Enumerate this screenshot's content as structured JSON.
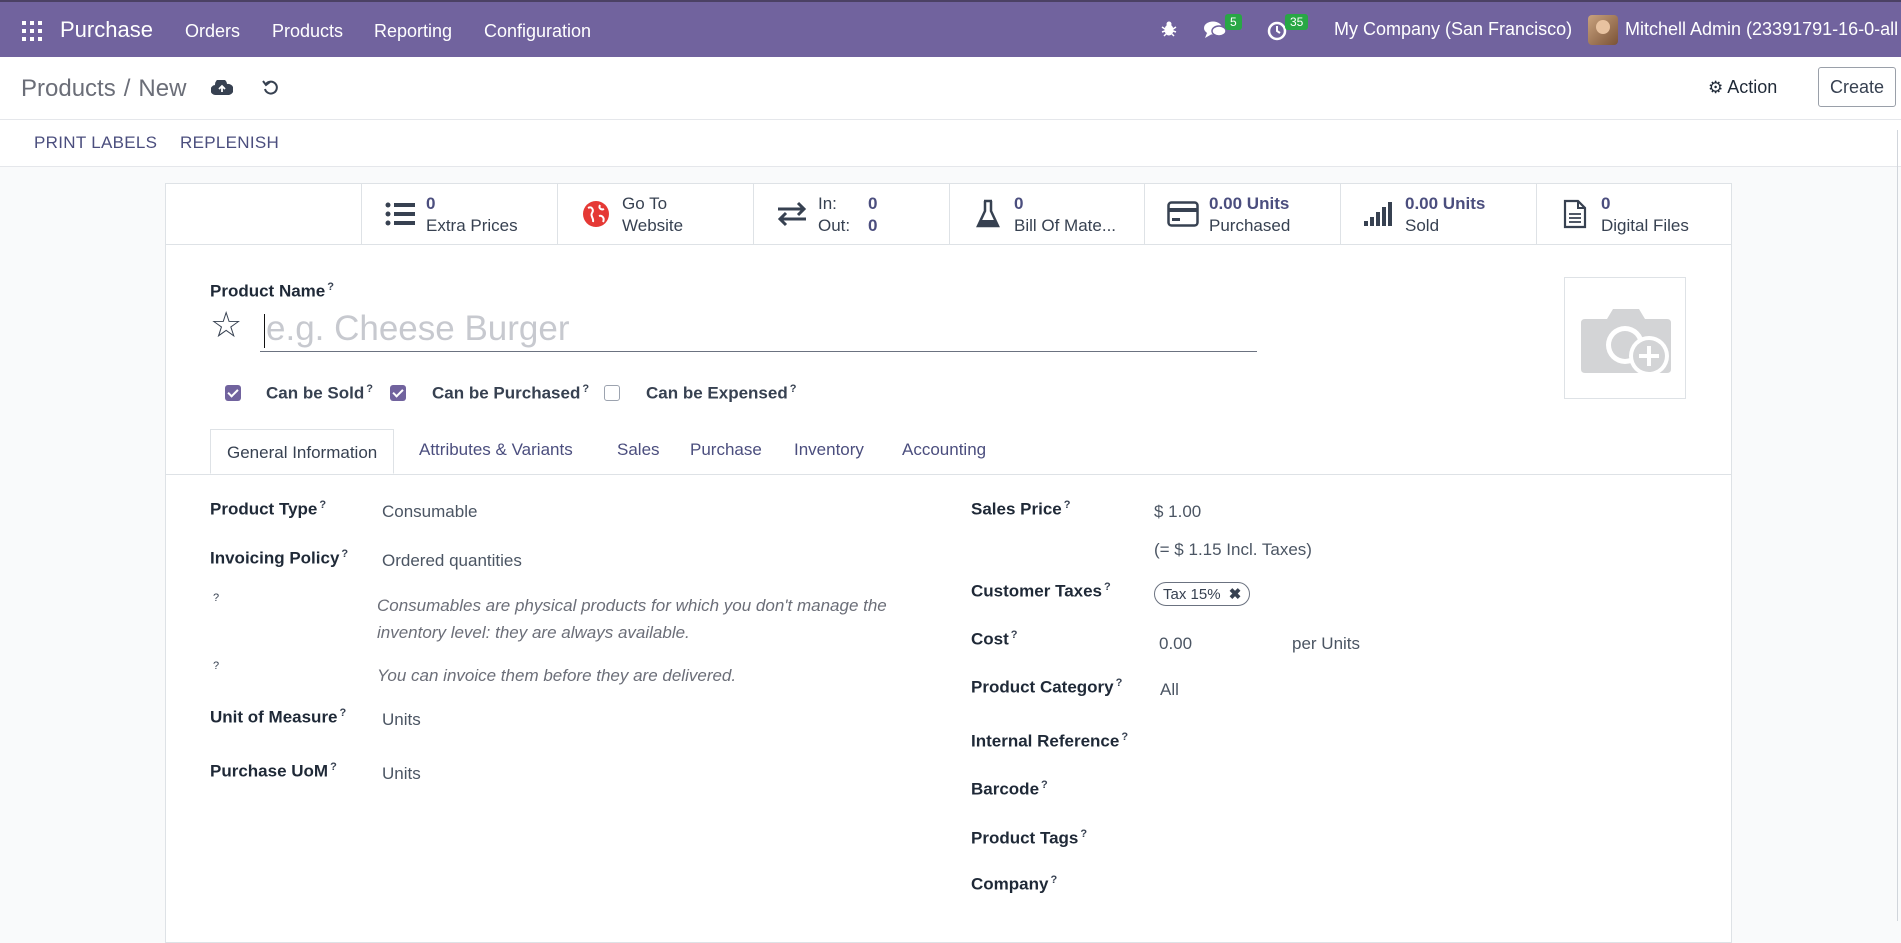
{
  "navbar": {
    "app": "Purchase",
    "menus": [
      "Orders",
      "Products",
      "Reporting",
      "Configuration"
    ],
    "messages_count": "5",
    "activities_count": "35",
    "company": "My Company (San Francisco)",
    "user": "Mitchell Admin (23391791-16-0-all"
  },
  "control_panel": {
    "breadcrumb_parent": "Products",
    "breadcrumb_sep": "/",
    "breadcrumb_current": "New",
    "action_label": "Action",
    "create_label": "Create"
  },
  "statusbar": {
    "print_labels": "PRINT LABELS",
    "replenish": "REPLENISH"
  },
  "smart_buttons": {
    "extra_prices": {
      "value": "0",
      "label": "Extra Prices"
    },
    "website": {
      "line1": "Go To",
      "line2": "Website"
    },
    "in_out": {
      "in_label": "In:",
      "in_value": "0",
      "out_label": "Out:",
      "out_value": "0"
    },
    "bom": {
      "value": "0",
      "label": "Bill Of Mate..."
    },
    "purchased": {
      "value": "0.00 Units",
      "label": "Purchased"
    },
    "sold": {
      "value": "0.00 Units",
      "label": "Sold"
    },
    "digital_files": {
      "value": "0",
      "label": "Digital Files"
    }
  },
  "form": {
    "product_name_label": "Product Name",
    "product_name_placeholder": "e.g. Cheese Burger",
    "can_be_sold": "Can be Sold",
    "can_be_purchased": "Can be Purchased",
    "can_be_expensed": "Can be Expensed",
    "tabs": [
      "General Information",
      "Attributes & Variants",
      "Sales",
      "Purchase",
      "Inventory",
      "Accounting"
    ],
    "left": {
      "product_type_label": "Product Type",
      "product_type_value": "Consumable",
      "invoicing_policy_label": "Invoicing Policy",
      "invoicing_policy_value": "Ordered quantities",
      "help_consumable": "Consumables are physical products for which you don't manage the inventory level: they are always available.",
      "help_invoice": "You can invoice them before they are delivered.",
      "uom_label": "Unit of Measure",
      "uom_value": "Units",
      "purchase_uom_label": "Purchase UoM",
      "purchase_uom_value": "Units"
    },
    "right": {
      "sales_price_label": "Sales Price",
      "sales_price_value": "$ 1.00",
      "sales_price_incl": "(= $ 1.15 Incl. Taxes)",
      "customer_taxes_label": "Customer Taxes",
      "customer_tax_tag": "Tax 15%",
      "cost_label": "Cost",
      "cost_value": "0.00",
      "cost_unit": "per Units",
      "product_category_label": "Product Category",
      "product_category_value": "All",
      "internal_reference_label": "Internal Reference",
      "barcode_label": "Barcode",
      "product_tags_label": "Product Tags",
      "company_label": "Company"
    },
    "help_marker": "?"
  }
}
